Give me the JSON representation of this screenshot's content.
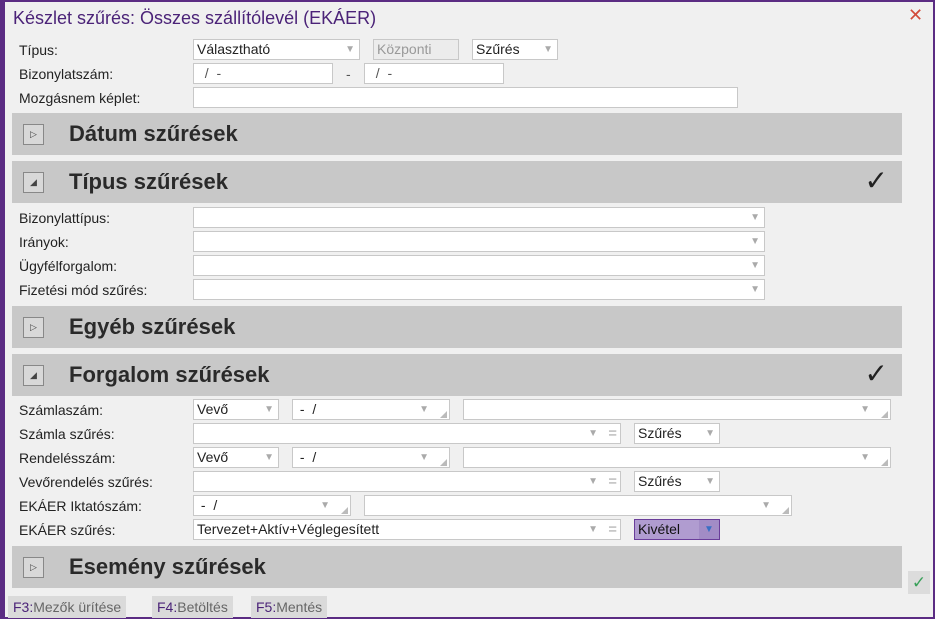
{
  "window": {
    "title": "Készlet szűrés: Összes szállítólevél (EKÁER)",
    "close": "✕"
  },
  "top": {
    "tipus": {
      "label": "Típus:",
      "value": "Választható",
      "kozponti": "Központi",
      "mode": "Szűrés"
    },
    "bizonylatszam": {
      "label": "Bizonylatszám:",
      "from": "  /  -",
      "sep": "-",
      "to": "  /  -"
    },
    "mozgasnem": {
      "label": "Mozgásnem képlet:",
      "value": ""
    }
  },
  "sections": {
    "datum": {
      "title": "Dátum szűrések",
      "expanded": false
    },
    "tipus": {
      "title": "Típus szűrések",
      "expanded": true,
      "active": true,
      "check": "✓"
    },
    "egyeb": {
      "title": "Egyéb szűrések",
      "expanded": false
    },
    "forgalom": {
      "title": "Forgalom szűrések",
      "expanded": true,
      "active": true,
      "check": "✓"
    },
    "esemeny": {
      "title": "Esemény szűrések",
      "expanded": false
    }
  },
  "tipus_fields": [
    {
      "label": "Bizonylattípus:",
      "value": ""
    },
    {
      "label": "Irányok:",
      "value": ""
    },
    {
      "label": "Ügyfélforgalom:",
      "value": ""
    },
    {
      "label": "Fizetési mód szűrés:",
      "value": ""
    }
  ],
  "forgalom_fields": {
    "szamlaszam": {
      "label": "Számlaszám:",
      "party": "Vevő",
      "number": " -  /",
      "value": ""
    },
    "szamla_szures": {
      "label": "Számla szűrés:",
      "value": "",
      "mode": "Szűrés"
    },
    "rendelesszam": {
      "label": "Rendelésszám:",
      "party": "Vevő",
      "number": " -  /",
      "value": ""
    },
    "vevorendeles_szures": {
      "label": "Vevőrendelés szűrés:",
      "value": "",
      "mode": "Szűrés"
    },
    "ekaer_iktatoszam": {
      "label": "EKÁER Iktatószám:",
      "number": " -  /",
      "value": ""
    },
    "ekaer_szures": {
      "label": "EKÁER szűrés:",
      "value": "Tervezet+Aktív+Véglegesített",
      "mode": "Kivétel"
    }
  },
  "footer": [
    {
      "key": "F3:",
      "label": "Mezők ürítése"
    },
    {
      "key": "F4:",
      "label": "Betöltés"
    },
    {
      "key": "F5:",
      "label": "Mentés"
    }
  ],
  "confirm": "✓",
  "colors": {
    "accent": "#5b2c83",
    "highlight": "#b09cd0",
    "close": "#d24a3a",
    "confirm": "#3aa05a"
  }
}
